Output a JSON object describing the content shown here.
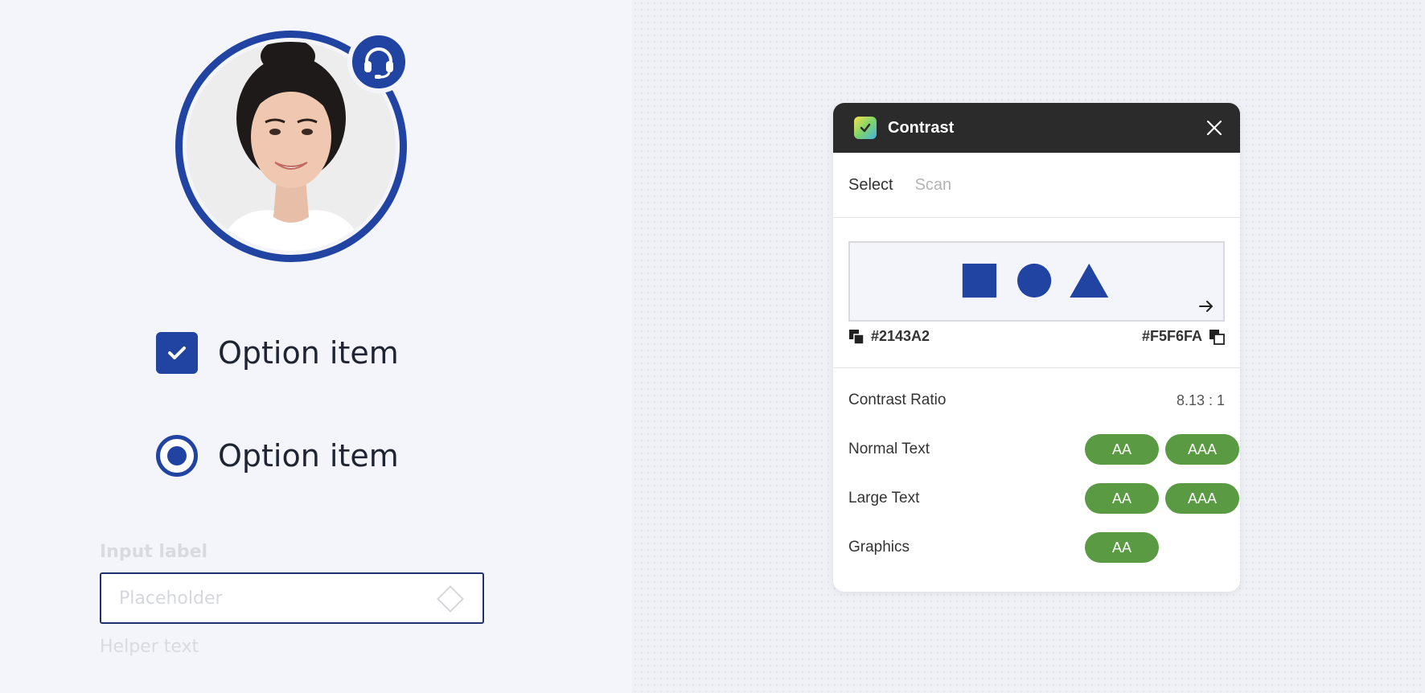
{
  "left": {
    "options": {
      "checkbox_label": "Option item",
      "radio_label": "Option item"
    },
    "input": {
      "label": "Input label",
      "placeholder": "Placeholder",
      "helper": "Helper text"
    }
  },
  "plugin": {
    "title": "Contrast",
    "tabs": [
      "Select",
      "Scan"
    ],
    "foreground_hex": "#2143A2",
    "background_hex": "#F5F6FA",
    "contrast_label": "Contrast Ratio",
    "contrast_value": "8.13 : 1",
    "rows": [
      {
        "label": "Normal Text",
        "badges": [
          "AA",
          "AAA"
        ]
      },
      {
        "label": "Large Text",
        "badges": [
          "AA",
          "AAA"
        ]
      },
      {
        "label": "Graphics",
        "badges": [
          "AA"
        ]
      }
    ]
  },
  "colors": {
    "brand": "#2143A2",
    "pass": "#5A9A42",
    "canvas": "#F4F5FA",
    "titlebar": "#2B2B2B"
  },
  "icons": [
    "headset-icon",
    "check-icon",
    "diamond-icon",
    "contrast-logo-icon",
    "close-icon",
    "arrow-right-icon",
    "swatch-icon"
  ]
}
